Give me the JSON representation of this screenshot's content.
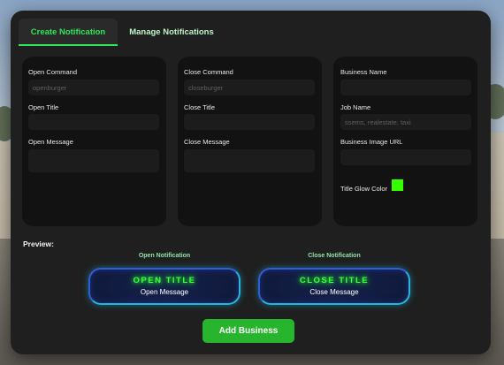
{
  "tabs": [
    {
      "label": "Create Notification",
      "active": true
    },
    {
      "label": "Manage Notifications",
      "active": false
    }
  ],
  "open_card": {
    "command_label": "Open Command",
    "command_placeholder": "openburger",
    "title_label": "Open Title",
    "message_label": "Open Message"
  },
  "close_card": {
    "command_label": "Close Command",
    "command_placeholder": "closeburger",
    "title_label": "Close Title",
    "message_label": "Close Message"
  },
  "business_card": {
    "name_label": "Business Name",
    "job_label": "Job Name",
    "job_placeholder": "ssems, realestate, taxi",
    "image_label": "Business Image URL",
    "glow_label": "Title Glow Color",
    "glow_color": "#38ff00"
  },
  "preview": {
    "label": "Preview:",
    "open_heading": "Open Notification",
    "open_title": "OPEN TITLE",
    "open_message": "Open Message",
    "close_heading": "Close Notification",
    "close_title": "CLOSE TITLE",
    "close_message": "Close Message"
  },
  "actions": {
    "add_label": "Add Business"
  },
  "colors": {
    "accent": "#2ee65a",
    "button": "#28b52e",
    "notif_border": "#22b6e0",
    "title_glow": "#3cff3c"
  }
}
